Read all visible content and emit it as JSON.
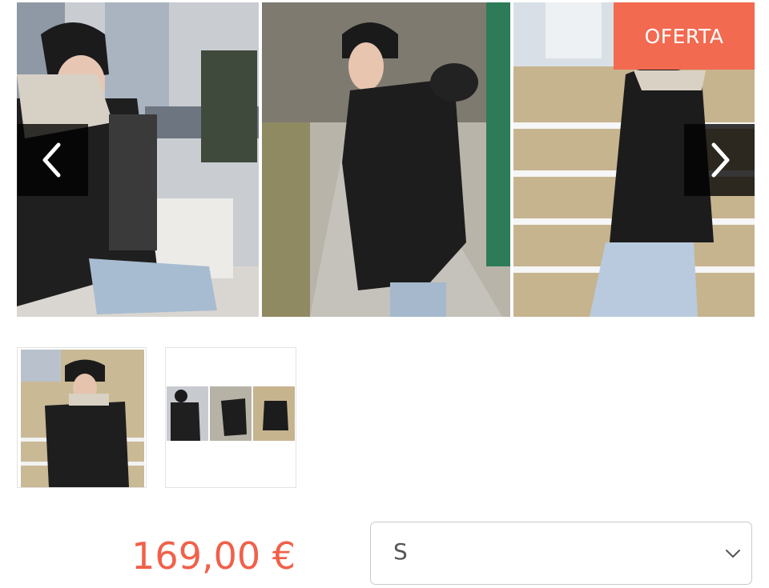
{
  "gallery": {
    "photos": [
      {
        "icon": "woman-seated-with-baby-carrier-jacket-photo"
      },
      {
        "icon": "woman-walking-in-black-jacket-photo"
      },
      {
        "icon": "woman-leaning-on-railing-photo"
      }
    ],
    "prev_icon": "chevron-left-icon",
    "next_icon": "chevron-right-icon",
    "badge_label": "OFERTA"
  },
  "thumbnails": [
    {
      "icon": "thumbnail-railing-photo"
    },
    {
      "icon": "thumbnail-three-photo-collage"
    }
  ],
  "product": {
    "price": "169,00 €",
    "size": {
      "selected": "S",
      "icon": "chevron-down-icon"
    }
  },
  "colors": {
    "accent": "#f26a50",
    "price": "#f0614a"
  }
}
